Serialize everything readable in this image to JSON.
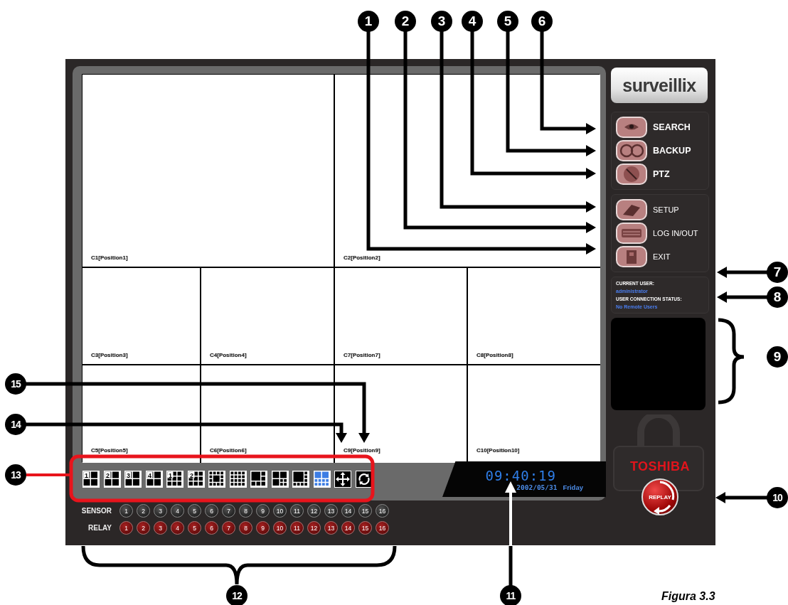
{
  "callouts": [
    {
      "label": "1"
    },
    {
      "label": "2"
    },
    {
      "label": "3"
    },
    {
      "label": "4"
    },
    {
      "label": "5"
    },
    {
      "label": "6"
    },
    {
      "label": "7"
    },
    {
      "label": "8"
    },
    {
      "label": "9"
    },
    {
      "label": "15"
    },
    {
      "label": "14"
    },
    {
      "label": "13"
    },
    {
      "label": "10"
    },
    {
      "label": "12"
    },
    {
      "label": "11"
    }
  ],
  "cameras": [
    {
      "label": "C1[Position1]"
    },
    {
      "label": "C2[Position2]"
    },
    {
      "label": "C3[Position3]"
    },
    {
      "label": "C4[Position4]"
    },
    {
      "label": "C7[Position7]"
    },
    {
      "label": "C8[Position8]"
    },
    {
      "label": "C5[Position5]"
    },
    {
      "label": "C6[Position6]"
    },
    {
      "label": "C9[Position9]"
    },
    {
      "label": "C10[Position10]"
    }
  ],
  "layout_buttons": [
    {
      "label": "1",
      "kind": "quad",
      "selected": false
    },
    {
      "label": "2",
      "kind": "quad",
      "selected": false
    },
    {
      "label": "3",
      "kind": "quad",
      "selected": false
    },
    {
      "label": "4",
      "kind": "quad",
      "selected": false
    },
    {
      "label": "1",
      "kind": "nine",
      "selected": false
    },
    {
      "label": "2",
      "kind": "nine",
      "selected": false
    },
    {
      "kind": "center",
      "selected": false
    },
    {
      "kind": "sixteen",
      "selected": false
    },
    {
      "kind": "six",
      "selected": false
    },
    {
      "kind": "seven",
      "selected": false
    },
    {
      "kind": "eight",
      "selected": false
    },
    {
      "kind": "ten",
      "selected": true
    }
  ],
  "view_controls": [
    {
      "kind": "fullscreen"
    },
    {
      "kind": "cycle"
    }
  ],
  "clock": {
    "time": "09:40:19",
    "date": "2002/05/31",
    "weekday": "Friday"
  },
  "sensor_row": {
    "label": "SENSOR",
    "items": [
      "1",
      "2",
      "3",
      "4",
      "5",
      "6",
      "7",
      "8",
      "9",
      "10",
      "11",
      "12",
      "13",
      "14",
      "15",
      "16"
    ]
  },
  "relay_row": {
    "label": "RELAY",
    "items": [
      "1",
      "2",
      "3",
      "4",
      "5",
      "6",
      "7",
      "8",
      "9",
      "10",
      "11",
      "12",
      "13",
      "14",
      "15",
      "16"
    ]
  },
  "logo": {
    "text": "surveillix"
  },
  "main_buttons": [
    {
      "label": "SEARCH",
      "kind": "eye"
    },
    {
      "label": "BACKUP",
      "kind": "reel"
    },
    {
      "label": "PTZ",
      "kind": "dial"
    }
  ],
  "system_buttons": [
    {
      "label": "SETUP",
      "kind": "tool"
    },
    {
      "label": "LOG IN/OUT",
      "kind": "keyboard"
    },
    {
      "label": "EXIT",
      "kind": "door"
    }
  ],
  "user_info": {
    "current_user_label": "CURRENT USER:",
    "current_user": "administrator",
    "status_label": "USER CONNECTION STATUS:",
    "status": "No Remote Users"
  },
  "brand": "TOSHIBA",
  "replay_button": {
    "label": "REPLAY"
  },
  "figure_caption": "Figura 3.3"
}
